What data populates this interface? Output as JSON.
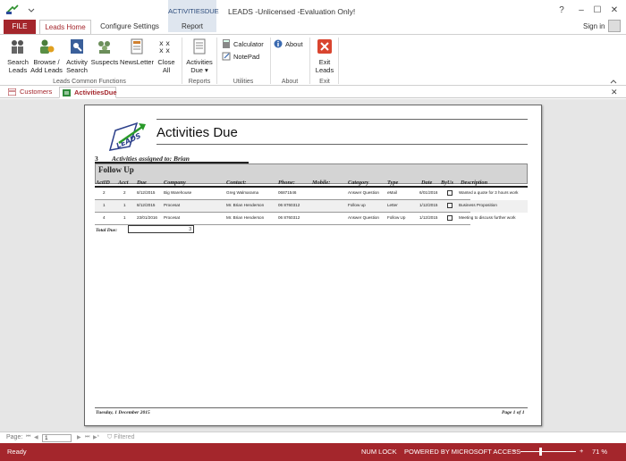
{
  "window": {
    "title": "LEADS -Unlicensed -Evaluation Only!",
    "context_group": "ACTIVITIESDUE",
    "help": "?",
    "minimize": "–",
    "restore": "☐",
    "close": "✕"
  },
  "tabs": {
    "file": "FILE",
    "items": [
      "Leads Home",
      "Configure Settings",
      "Report"
    ],
    "active": "Leads Home",
    "sign_in": "Sign in"
  },
  "ribbon": {
    "buttons": [
      {
        "label1": "Search",
        "label2": "Leads"
      },
      {
        "label1": "Browse /",
        "label2": "Add Leads"
      },
      {
        "label1": "Activity",
        "label2": "Search"
      },
      {
        "label1": "Suspects",
        "label2": ""
      },
      {
        "label1": "NewsLetter",
        "label2": ""
      },
      {
        "label1": "Close",
        "label2": "All"
      },
      {
        "label1": "Activities",
        "label2": "Due ▾"
      },
      {
        "label1": "Exit",
        "label2": "Leads"
      }
    ],
    "calculator": "Calculator",
    "notepad": "NotePad",
    "about": "About",
    "groups": [
      "Leads Common Functions",
      "Reports",
      "Utilities",
      "About",
      "Exit"
    ]
  },
  "doc_tabs": {
    "items": [
      "Customers",
      "ActivitiesDue"
    ],
    "active": "ActivitiesDue",
    "close": "✕"
  },
  "report": {
    "title": "Activities Due",
    "count": "3",
    "assigned": "Activities assigned to:  Brian",
    "group": "Follow Up",
    "columns": [
      "ActID",
      "Acct",
      "Due",
      "Company",
      "Contact:",
      "Phone:",
      "Mobile:",
      "Category",
      "Type",
      "Date",
      "ByUs",
      "Description"
    ],
    "rows": [
      {
        "actid": "2",
        "acct": "2",
        "due": "8/12/2015",
        "company": "Big Warehouse",
        "contact": "Greg Walmarama",
        "phone": "06871546",
        "mobile": "",
        "category": "Answer Question",
        "type": "eMail",
        "date": "6/01/2016",
        "byus": false,
        "description": "Wanted a quote for 3 hours work"
      },
      {
        "actid": "1",
        "acct": "1",
        "due": "8/12/2015",
        "company": "Procesat",
        "contact": "Mr. Brian Henderson",
        "phone": "06 8760312",
        "mobile": "",
        "category": "Follow up",
        "type": "Letter",
        "date": "1/12/2015",
        "byus": false,
        "description": "Business Proposition"
      },
      {
        "actid": "4",
        "acct": "1",
        "due": "23/01/2016",
        "company": "Procesat",
        "contact": "Mr. Brian Henderson",
        "phone": "06 8760312",
        "mobile": "",
        "category": "Answer Question",
        "type": "Follow Up",
        "date": "1/12/2015",
        "byus": false,
        "description": "Meeting to discuss further work"
      }
    ],
    "total_label": "Total Due:",
    "total_value": "3",
    "footer_date": "Tuesday, 1 December 2015",
    "footer_page": "Page 1 of 1"
  },
  "navbar": {
    "page_label": "Page:",
    "page_value": "1",
    "filter": "Filtered"
  },
  "status": {
    "ready": "Ready",
    "numlock": "NUM LOCK",
    "powered": "POWERED BY MICROSOFT ACCESS",
    "zoom_minus": "−",
    "zoom_plus": "+",
    "zoom": "71 %",
    "zoom_level": 0.71
  },
  "colors": {
    "accent": "#a4262c",
    "context_tab": "#dfe6ef"
  }
}
